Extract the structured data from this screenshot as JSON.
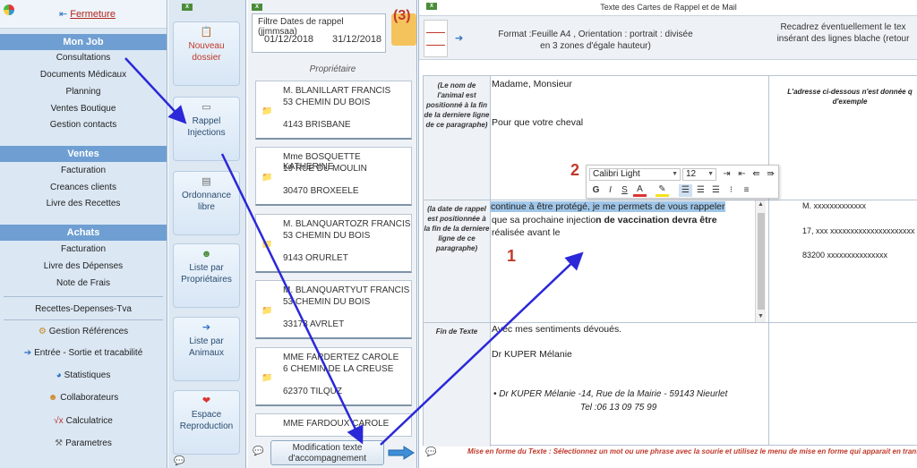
{
  "left_nav": {
    "fermeture": "Fermeture",
    "sections": {
      "monjob": "Mon Job",
      "ventes": "Ventes",
      "achats": "Achats"
    },
    "monjob_items": [
      "Consultations",
      "Documents Médicaux",
      "Planning",
      "Ventes Boutique",
      "Gestion contacts"
    ],
    "ventes_items": [
      "Facturation",
      "Creances clients",
      "Livre des Recettes"
    ],
    "achats_items": [
      "Facturation",
      "Livre des Dépenses",
      "Note de Frais"
    ],
    "bottom_items": [
      "Recettes-Depenses-Tva",
      "Gestion Références",
      "Entrée - Sortie et tracabilité",
      "Statistiques",
      "Collaborateurs",
      "Calculatrice",
      "Parametres"
    ]
  },
  "button_column": {
    "nouveau": [
      "Nouveau",
      "dossier"
    ],
    "rappel": [
      "Rappel",
      "Injections"
    ],
    "ordonnance": [
      "Ordonnance",
      "libre"
    ],
    "liste_proprio": [
      "Liste par",
      "Propriétaires"
    ],
    "liste_animaux": [
      "Liste par",
      "Animaux"
    ],
    "espace": [
      "Espace",
      "Reproduction"
    ]
  },
  "owners_column": {
    "filter_title": "Filtre Dates de rappel (jjmmsaa)",
    "date_from": "01/12/2018",
    "date_to": "31/12/2018",
    "step_marker": "(3)",
    "proprietaire_label": "Propriétaire",
    "cards": [
      {
        "name": "M. BLANILLART FRANCIS",
        "street": "53 CHEMIN DU BOIS",
        "city": "4143 BRISBANE"
      },
      {
        "name": "Mme BOSQUETTE KATHERINE",
        "street": "19 RUE DU MOULIN",
        "city": "30470 BROXEELE"
      },
      {
        "name": "M. BLANQUARTOZR FRANCIS",
        "street": "53 CHEMIN DU BOIS",
        "city": "9143 ORURLET"
      },
      {
        "name": "M. BLANQUARTYUT FRANCIS",
        "street": "53 CHEMIN DU BOIS",
        "city": "33173 AVRLET"
      },
      {
        "name": "MME FARDERTEZ CAROLE",
        "street": "6 CHEMIN DE LA CREUSE",
        "city": "62370 TILQUZ"
      },
      {
        "name": "MME FARDOUX CAROLE",
        "street": "",
        "city": ""
      }
    ],
    "modify_button": [
      "Modification texte",
      "d'accompagnement"
    ]
  },
  "main": {
    "title": "Texte des Cartes de Rappel et de Mail",
    "format_line1": "Format :Feuille A4 , Orientation  : portrait : divisée",
    "format_line2": "en 3 zones d'égale hauteur)",
    "recadrez_line1": "Recadrez éventuellement le tex",
    "recadrez_line2": "insérant des lignes blache (retour",
    "row1_label": "(Le nom de l'animal est positionné à la fin  de la derniere ligne de ce paragraphe)",
    "row1_text1": "Madame, Monsieur",
    "row1_text2": "Pour que votre cheval",
    "row2_label": "(la date de rappel est positionnée à la fin de la derniere ligne de ce paragraphe)",
    "row2_hl": "continue à être protégé, je me permets de vous rappeler",
    "row2_line2a": "que sa prochaine injectio",
    "row2_line2b": "n de vaccination devra être",
    "row2_line3": "réalisée avant le",
    "row3_label": "Fin de Texte",
    "row3_text1": "Avec mes sentiments dévoués.",
    "row3_text2": "Dr KUPER Mélanie",
    "row3_text3": "• Dr KUPER Mélanie -14, Rue de la Mairie - 59143 Nieurlet",
    "row3_text4": "Tel :06 13 09 75 99",
    "right_note_line1": "L'adresse ci-dessous n'est donnée q",
    "right_note_line2": "d'exemple",
    "addr1": "M. xxxxxxxxxxxxx",
    "addr2": "17, xxx xxxxxxxxxxxxxxxxxxxxx",
    "addr3": "83200   xxxxxxxxxxxxxxx",
    "status": "Mise en forme du Texte : Sélectionnez un mot ou une phrase avec la sourie et utilisez le menu de mise en forme qui apparait en trans"
  },
  "toolbar": {
    "font": "Calibri Light",
    "size": "12",
    "buttons": [
      "G",
      "I",
      "S",
      "A"
    ]
  },
  "markers": {
    "one": "1",
    "two": "2"
  }
}
